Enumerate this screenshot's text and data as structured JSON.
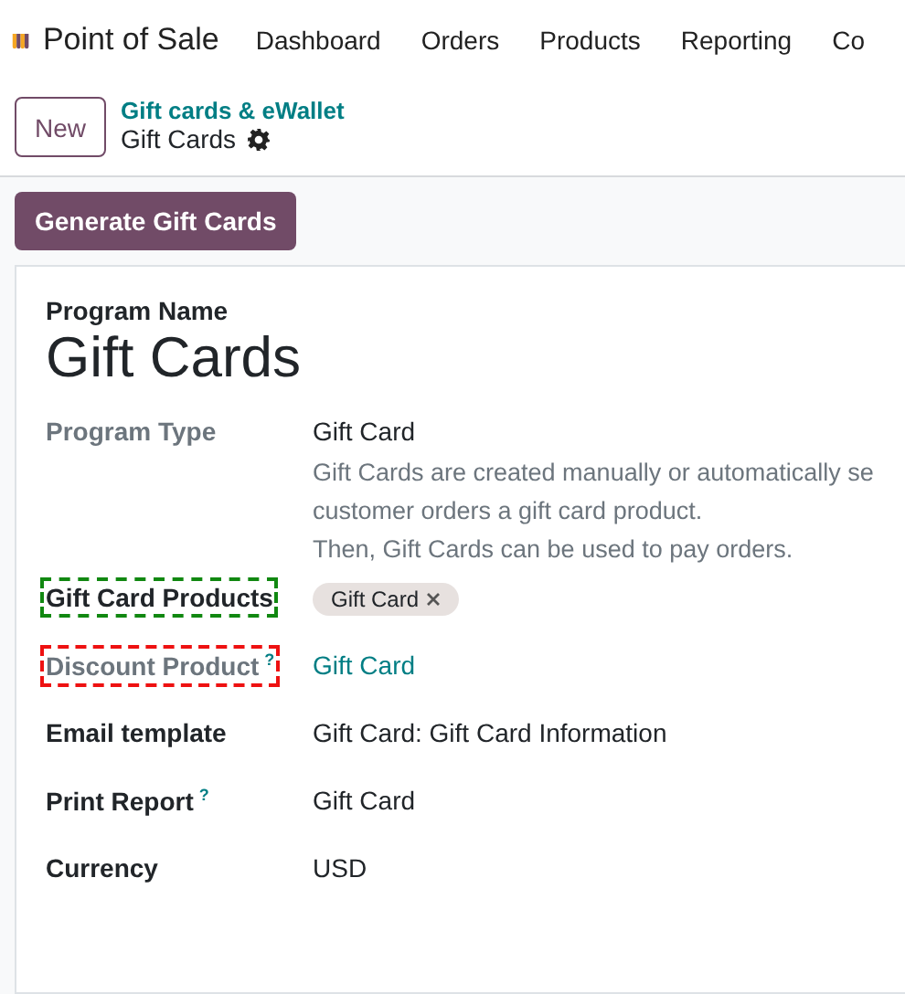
{
  "app": {
    "name": "Point of Sale"
  },
  "nav": [
    "Dashboard",
    "Orders",
    "Products",
    "Reporting",
    "Co"
  ],
  "control_panel": {
    "new_button": "New",
    "breadcrumb": "Gift cards & eWallet",
    "title": "Gift Cards"
  },
  "action_button": "Generate Gift Cards",
  "form": {
    "name_label": "Program Name",
    "name": "Gift Cards",
    "fields": [
      {
        "kind": "text",
        "label": "Program Type",
        "muted": true,
        "value": "Gift Card",
        "description": [
          "Gift Cards are created manually or automatically se",
          "customer orders a gift card product.",
          "Then, Gift Cards can be used to pay orders."
        ]
      },
      {
        "kind": "tags",
        "label": "Gift Card Products",
        "muted": false,
        "color": "#118811",
        "tags": [
          "Gift Card"
        ]
      },
      {
        "kind": "link",
        "label": "Discount Product",
        "muted": true,
        "help": "?",
        "color": "#ee1111",
        "value": "Gift Card"
      },
      {
        "kind": "text",
        "label": "Email template",
        "muted": false,
        "value": "Gift Card: Gift Card Information"
      },
      {
        "kind": "text",
        "label": "Print Report",
        "muted": false,
        "help": "?",
        "value": "Gift Card"
      },
      {
        "kind": "text",
        "label": "Currency",
        "muted": false,
        "value": "USD"
      }
    ]
  }
}
